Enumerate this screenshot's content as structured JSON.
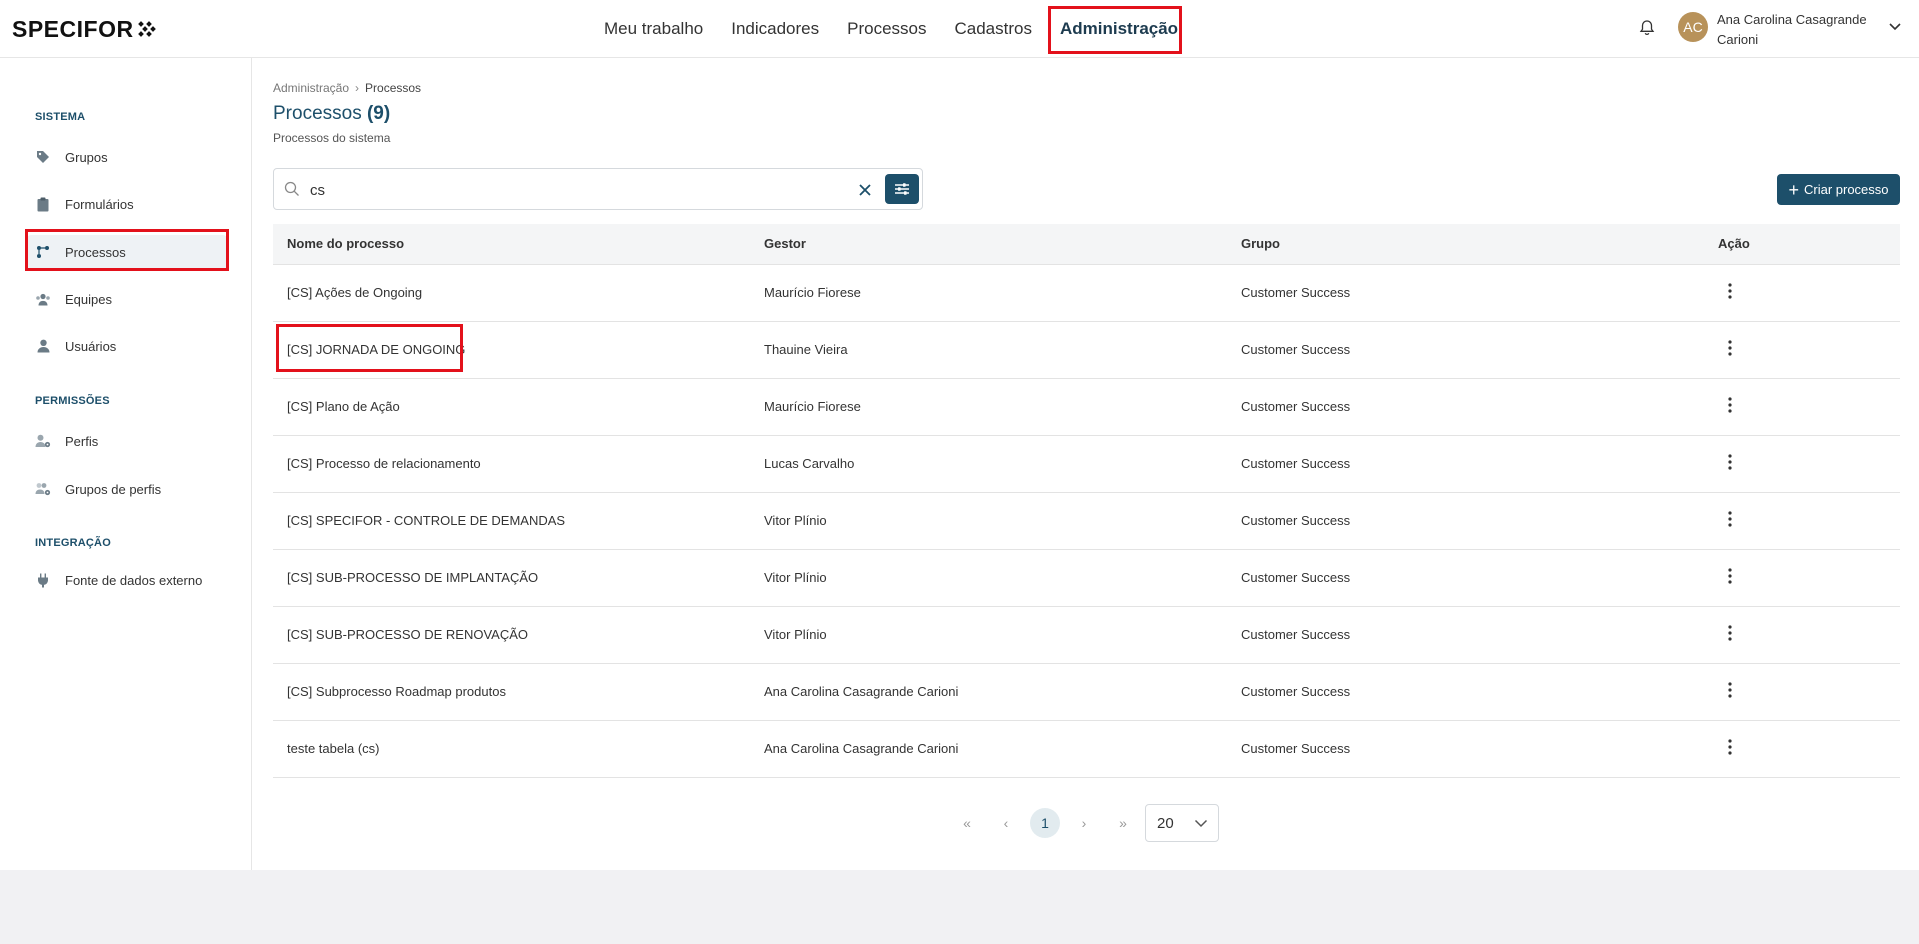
{
  "brand": {
    "logo_text": "SPECIFOR"
  },
  "topnav": {
    "items": [
      "Meu trabalho",
      "Indicadores",
      "Processos",
      "Cadastros",
      "Administração"
    ],
    "active": "Administração"
  },
  "user": {
    "initials": "AC",
    "name": "Ana Carolina Casagrande Carioni"
  },
  "sidebar": {
    "sections": [
      {
        "title": "SISTEMA",
        "items": [
          "Grupos",
          "Formulários",
          "Processos",
          "Equipes",
          "Usuários"
        ]
      },
      {
        "title": "PERMISSÕES",
        "items": [
          "Perfis",
          "Grupos de perfis"
        ]
      },
      {
        "title": "INTEGRAÇÃO",
        "items": [
          "Fonte de dados externo"
        ]
      }
    ],
    "active": "Processos"
  },
  "breadcrumb": {
    "parent": "Administração",
    "current": "Processos"
  },
  "page": {
    "title": "Processos",
    "count": "(9)",
    "subtitle": "Processos do sistema"
  },
  "search": {
    "value": "cs"
  },
  "create_button": {
    "label": "Criar processo"
  },
  "table": {
    "headers": [
      "Nome do processo",
      "Gestor",
      "Grupo",
      "Ação"
    ],
    "rows": [
      [
        "[CS] Ações de Ongoing",
        "Maurício Fiorese",
        "Customer Success"
      ],
      [
        "[CS] JORNADA DE ONGOING",
        "Thauine Vieira",
        "Customer Success"
      ],
      [
        "[CS] Plano de Ação",
        "Maurício Fiorese",
        "Customer Success"
      ],
      [
        "[CS] Processo de relacionamento",
        "Lucas Carvalho",
        "Customer Success"
      ],
      [
        "[CS] SPECIFOR - CONTROLE DE DEMANDAS",
        "Vitor Plínio",
        "Customer Success"
      ],
      [
        "[CS] SUB-PROCESSO DE IMPLANTAÇÃO",
        "Vitor Plínio",
        "Customer Success"
      ],
      [
        "[CS] SUB-PROCESSO DE RENOVAÇÃO",
        "Vitor Plínio",
        "Customer Success"
      ],
      [
        "[CS] Subprocesso Roadmap produtos",
        "Ana Carolina Casagrande Carioni",
        "Customer Success"
      ],
      [
        "teste tabela (cs)",
        "Ana Carolina Casagrande Carioni",
        "Customer Success"
      ]
    ]
  },
  "pagination": {
    "current_page": "1",
    "per_page": "20"
  },
  "colors": {
    "primary": "#1d4f6a",
    "highlight": "#e3111b"
  }
}
